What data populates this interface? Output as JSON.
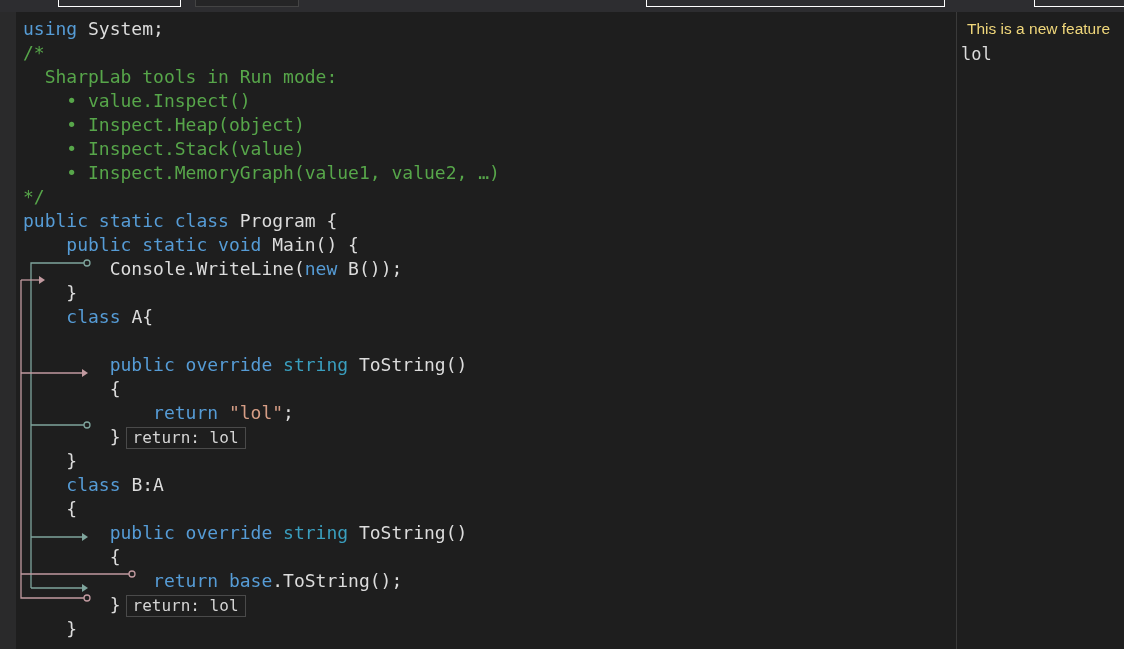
{
  "editor": {
    "lines": [
      [
        {
          "kind": "keyword",
          "text": "using"
        },
        {
          "kind": "plain",
          "text": " System;"
        }
      ],
      [
        {
          "kind": "comment",
          "text": "/*"
        }
      ],
      [
        {
          "kind": "comment",
          "text": "  SharpLab tools in Run mode:"
        }
      ],
      [
        {
          "kind": "comment",
          "text": "    • value.Inspect()"
        }
      ],
      [
        {
          "kind": "comment",
          "text": "    • Inspect.Heap(object)"
        }
      ],
      [
        {
          "kind": "comment",
          "text": "    • Inspect.Stack(value)"
        }
      ],
      [
        {
          "kind": "comment",
          "text": "    • Inspect.MemoryGraph(value1, value2, …)"
        }
      ],
      [
        {
          "kind": "comment",
          "text": "*/"
        }
      ],
      [
        {
          "kind": "keyword",
          "text": "public static class"
        },
        {
          "kind": "plain",
          "text": " Program {"
        }
      ],
      [
        {
          "kind": "keyword",
          "text": "    public static void"
        },
        {
          "kind": "plain",
          "text": " Main() {"
        }
      ],
      [
        {
          "kind": "plain",
          "text": "        Console.WriteLine("
        },
        {
          "kind": "keyword",
          "text": "new"
        },
        {
          "kind": "plain",
          "text": " B());"
        }
      ],
      [
        {
          "kind": "plain",
          "text": "    }"
        }
      ],
      [
        {
          "kind": "keyword",
          "text": "    class"
        },
        {
          "kind": "plain",
          "text": " A{"
        }
      ],
      [
        {
          "kind": "spacer"
        },
        {
          "kind": "keyword",
          "text": "        public override"
        },
        {
          "kind": "type",
          "text": " string"
        },
        {
          "kind": "plain",
          "text": " ToString()"
        }
      ],
      [
        {
          "kind": "plain",
          "text": "        {"
        }
      ],
      [
        {
          "kind": "keyword",
          "text": "            return"
        },
        {
          "kind": "string",
          "text": " \"lol\""
        },
        {
          "kind": "plain",
          "text": ";"
        }
      ],
      [
        {
          "kind": "plain",
          "text": "        }"
        },
        {
          "kind": "hint",
          "text": "return: lol"
        }
      ],
      [
        {
          "kind": "plain",
          "text": "    }"
        }
      ],
      [
        {
          "kind": "keyword",
          "text": "    class"
        },
        {
          "kind": "plain",
          "text": " B:A"
        }
      ],
      [
        {
          "kind": "plain",
          "text": "    {"
        }
      ],
      [
        {
          "kind": "keyword",
          "text": "        public override"
        },
        {
          "kind": "type",
          "text": " string"
        },
        {
          "kind": "plain",
          "text": " ToString()"
        }
      ],
      [
        {
          "kind": "plain",
          "text": "        {"
        }
      ],
      [
        {
          "kind": "keyword",
          "text": "            return base"
        },
        {
          "kind": "plain",
          "text": ".ToString();"
        }
      ],
      [
        {
          "kind": "plain",
          "text": "        }"
        },
        {
          "kind": "hint",
          "text": "return: lol"
        }
      ],
      [
        {
          "kind": "plain",
          "text": "    }"
        }
      ]
    ]
  },
  "output": {
    "notice": "This is a new feature",
    "text": "lol"
  }
}
